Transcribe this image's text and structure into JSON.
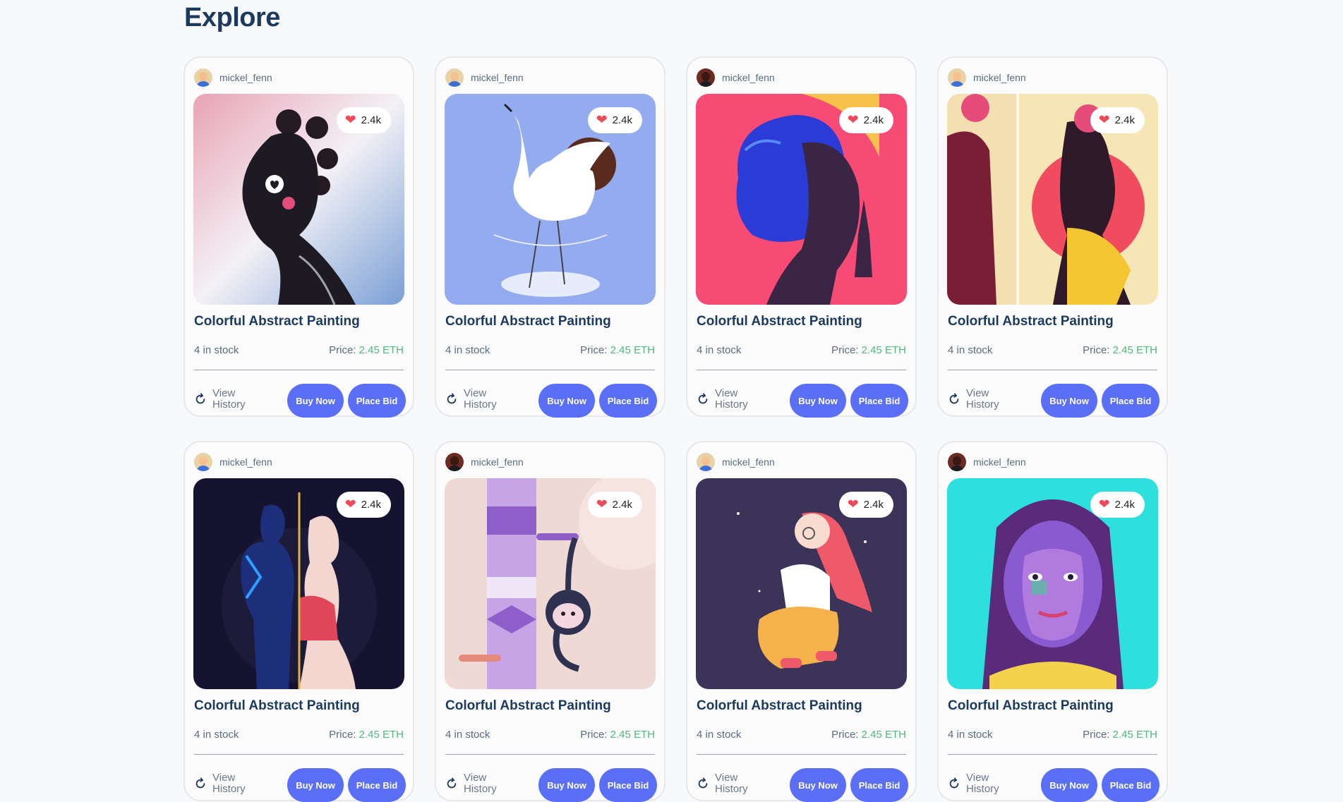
{
  "page": {
    "title": "Explore"
  },
  "card_template": {
    "history_label": "View History",
    "buy_label": "Buy Now",
    "bid_label": "Place Bid",
    "price_prefix": "Price: "
  },
  "colors": {
    "accent": "#5a6ff6",
    "eth": "#4fb87e",
    "heart": "#ef4a5a",
    "title": "#1c3a5e"
  },
  "cards": [
    {
      "creator": "mickel_fenn",
      "avatar": "light",
      "likes": "2.4k",
      "title": "Colorful Abstract Painting",
      "stock": "4 in stock",
      "price": "2.45 ETH",
      "art": "art-profile-heart"
    },
    {
      "creator": "mickel_fenn",
      "avatar": "light",
      "likes": "2.4k",
      "title": "Colorful Abstract Painting",
      "stock": "4 in stock",
      "price": "2.45 ETH",
      "art": "art-crane"
    },
    {
      "creator": "mickel_fenn",
      "avatar": "dark",
      "likes": "2.4k",
      "title": "Colorful Abstract Painting",
      "stock": "4 in stock",
      "price": "2.45 ETH",
      "art": "art-blue-hair"
    },
    {
      "creator": "mickel_fenn",
      "avatar": "light",
      "likes": "2.4k",
      "title": "Colorful Abstract Painting",
      "stock": "4 in stock",
      "price": "2.45 ETH",
      "art": "art-diptych"
    },
    {
      "creator": "mickel_fenn",
      "avatar": "light",
      "likes": "2.4k",
      "title": "Colorful Abstract Painting",
      "stock": "4 in stock",
      "price": "2.45 ETH",
      "art": "art-couple"
    },
    {
      "creator": "mickel_fenn",
      "avatar": "dark",
      "likes": "2.4k",
      "title": "Colorful Abstract Painting",
      "stock": "4 in stock",
      "price": "2.45 ETH",
      "art": "art-monkey-totem"
    },
    {
      "creator": "mickel_fenn",
      "avatar": "light",
      "likes": "2.4k",
      "title": "Colorful Abstract Painting",
      "stock": "4 in stock",
      "price": "2.45 ETH",
      "art": "art-girl-sitting"
    },
    {
      "creator": "mickel_fenn",
      "avatar": "dark",
      "likes": "2.4k",
      "title": "Colorful Abstract Painting",
      "stock": "4 in stock",
      "price": "2.45 ETH",
      "art": "art-portrait-teal"
    }
  ]
}
